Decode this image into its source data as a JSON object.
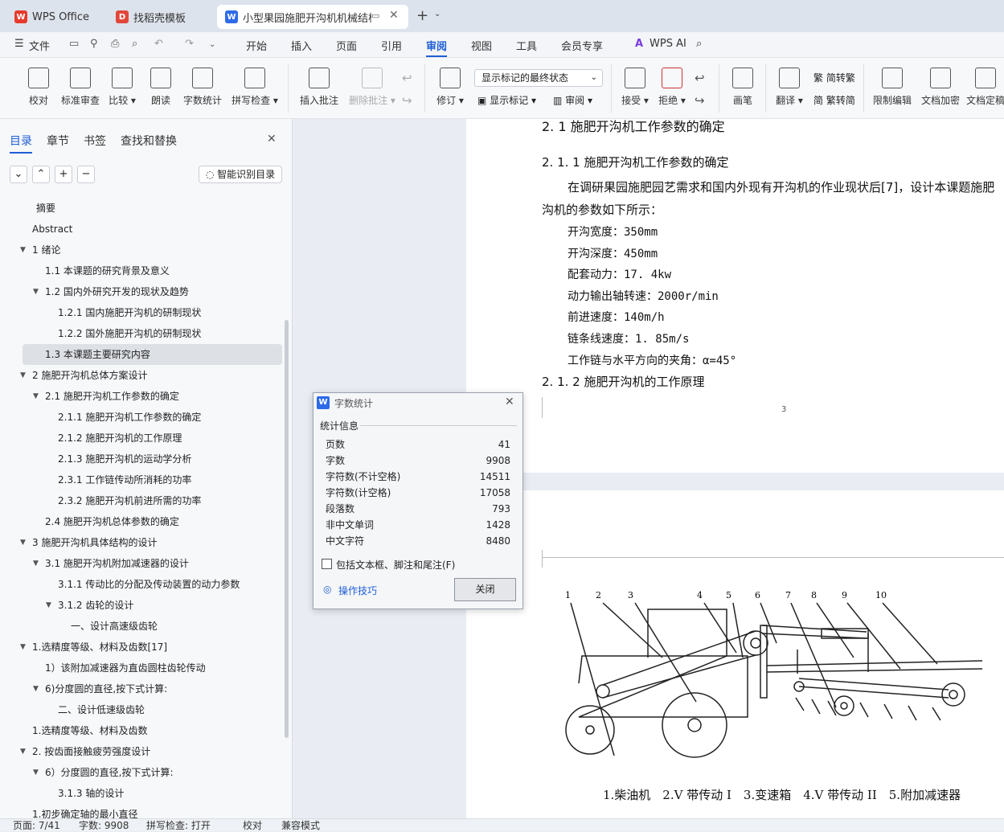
{
  "tabs": [
    {
      "label": "WPS Office"
    },
    {
      "label": "找稻壳模板"
    },
    {
      "label": "小型果园施肥开沟机机械结构"
    }
  ],
  "menu": {
    "file": "文件",
    "items": [
      "开始",
      "插入",
      "页面",
      "引用",
      "审阅",
      "视图",
      "工具",
      "会员专享"
    ],
    "ai": "WPS AI"
  },
  "ribbon": {
    "proofread": "校对",
    "std_review": "标准审查",
    "compare": "比较",
    "read_aloud": "朗读",
    "word_count": "字数统计",
    "spell_check": "拼写检查",
    "insert_comment": "插入批注",
    "delete_comment": "删除批注",
    "track": "修订",
    "markup_select": "显示标记的最终状态",
    "show_markup": "显示标记",
    "review": "审阅",
    "accept": "接受",
    "reject": "拒绝",
    "pen": "画笔",
    "translate": "翻译",
    "to_trad": "简转繁",
    "to_simp": "繁转简",
    "restrict": "限制编辑",
    "encrypt": "文档加密",
    "doc_fixed": "文档定稿"
  },
  "nav": {
    "tabs": [
      "目录",
      "章节",
      "书签",
      "查找和替换"
    ],
    "smart_btn": "智能识别目录",
    "items": [
      "摘要",
      "Abstract",
      "1 绪论",
      "1.1 本课题的研究背景及意义",
      "1.2 国内外研究开发的现状及趋势",
      "1.2.1 国内施肥开沟机的研制现状",
      "1.2.2 国外施肥开沟机的研制现状",
      "1.3 本课题主要研究内容",
      "2 施肥开沟机总体方案设计",
      "2.1 施肥开沟机工作参数的确定",
      "2.1.1 施肥开沟机工作参数的确定",
      "2.1.2 施肥开沟机的工作原理",
      "2.1.3 施肥开沟机的运动学分析",
      "2.3.1 工作链传动所消耗的功率",
      "2.3.2 施肥开沟机前进所需的功率",
      "2.4 施肥开沟机总体参数的确定",
      "3 施肥开沟机具体结构的设计",
      "3.1 施肥开沟机附加减速器的设计",
      "3.1.1 传动比的分配及传动装置的动力参数",
      "3.1.2 齿轮的设计",
      "一、设计高速级齿轮",
      "1.选精度等级、材料及齿数[17]",
      "1）该附加减速器为直齿圆柱齿轮传动",
      "6)分度圆的直径,按下式计算:",
      "二、设计低速级齿轮",
      "1.选精度等级、材料及齿数",
      "2. 按齿面接触疲劳强度设计",
      "6）分度圆的直径,按下式计算:",
      "3.1.3 轴的设计",
      "1.初步确定轴的最小直径"
    ]
  },
  "doc": {
    "heading_cut": "2. 1 施肥开沟机工作参数的确定",
    "h1": "2. 1. 1 施肥开沟机工作参数的确定",
    "p1": "在调研果园施肥园艺需求和国内外现有开沟机的作业现状后[7]，设计本课题施肥",
    "p1b": "沟机的参数如下所示：",
    "params": [
      "开沟宽度：350mm",
      "开沟深度：450mm",
      "配套动力：17. 4kw",
      "动力输出轴转速：2000r/min",
      "前进速度：140m/h",
      "链条线速度：1. 85m/s",
      "工作链与水平方向的夹角：α=45°"
    ],
    "h2": "2. 1. 2 施肥开沟机的工作原理",
    "page_no": "3",
    "fig_nums": [
      "1",
      "2",
      "3",
      "4",
      "5",
      "6",
      "7",
      "8",
      "9",
      "10"
    ],
    "caption": "1.柴油机　2.V 带传动 I　3.变速箱　4.V 带传动 II　5.附加减速器"
  },
  "dialog": {
    "title": "字数统计",
    "section": "统计信息",
    "rows": [
      {
        "k": "页数",
        "v": "41"
      },
      {
        "k": "字数",
        "v": "9908"
      },
      {
        "k": "字符数(不计空格)",
        "v": "14511"
      },
      {
        "k": "字符数(计空格)",
        "v": "17058"
      },
      {
        "k": "段落数",
        "v": "793"
      },
      {
        "k": "非中文单词",
        "v": "1428"
      },
      {
        "k": "中文字符",
        "v": "8480"
      }
    ],
    "checkbox": "包括文本框、脚注和尾注(F)",
    "tips": "操作技巧",
    "close": "关闭"
  },
  "status": {
    "page": "页面: 7/41",
    "words": "字数: 9908",
    "spell": "拼写检查: 打开",
    "proof": "校对",
    "compat": "兼容模式"
  }
}
